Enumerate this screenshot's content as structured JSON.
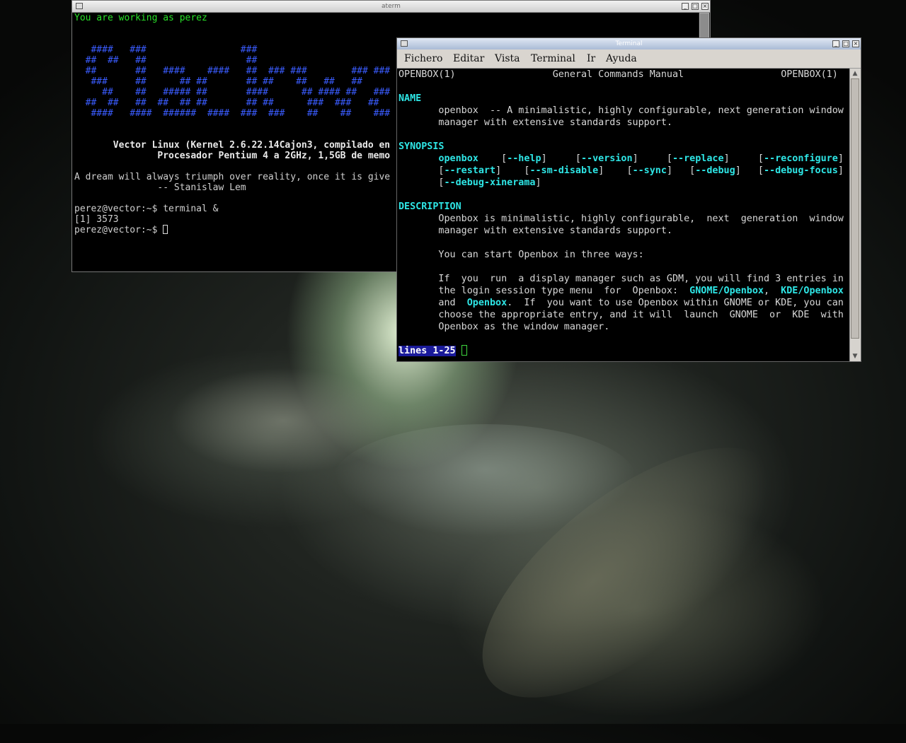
{
  "aterm": {
    "title": "aterm",
    "lines": [
      "You are working as perez",
      "",
      "",
      "   ####   ###                 ###",
      "  ##  ##   ##                  ##",
      "  ##       ##   ####    ####   ##  ### ###        ### ###",
      "   ###     ##      ## ##       ## ##    ##   ##   ##",
      "     ##    ##   ##### ##       ####      ## #### ##   ###",
      "  ##  ##   ##  ##  ## ##       ## ##      ###  ###   ##",
      "   ####   ####  ######  ####  ###  ###    ##    ##    ###",
      "",
      "",
      "       Vector Linux (Kernel 2.6.22.14Cajon3, compilado en",
      "               Procesador Pentium 4 a 2GHz, 1,5GB de memo",
      "",
      "A dream will always triumph over reality, once it is give",
      "               -- Stanislaw Lem",
      "",
      "perez@vector:~$ terminal &",
      "[1] 3573",
      "perez@vector:~$ "
    ]
  },
  "terminal": {
    "title": "Terminal",
    "menu": [
      "Fichero",
      "Editar",
      "Vista",
      "Terminal",
      "Ir",
      "Ayuda"
    ],
    "header_left": "OPENBOX(1)",
    "header_center": "General Commands Manual",
    "header_right": "OPENBOX(1)",
    "sections": {
      "name_heading": "NAME",
      "name_text_1": "       openbox  -- A minimalistic, highly configurable, next generation window",
      "name_text_2": "       manager with extensive standards support.",
      "synopsis_heading": "SYNOPSIS",
      "synopsis_cmd": "openbox",
      "options_line1": [
        "--help",
        "--version",
        "--replace",
        "--reconfigure"
      ],
      "options_line2": [
        "--restart",
        "--sm-disable",
        "--sync",
        "--debug",
        "--debug-focus"
      ],
      "options_line3": [
        "--debug-xinerama"
      ],
      "description_heading": "DESCRIPTION",
      "desc_1": "       Openbox is minimalistic, highly configurable,  next  generation  window",
      "desc_2": "       manager with extensive standards support.",
      "desc_3": "       You can start Openbox in three ways:",
      "desc_4": "       If  you  run  a display manager such as GDM, you will find 3 entries in",
      "desc_5a": "       the login session type menu  for  Openbox:  ",
      "link_gnome": "GNOME/Openbox",
      "link_kde": "KDE/Openbox",
      "desc_6a": "       and  ",
      "link_openbox": "Openbox",
      "desc_6b": ".  If  you want to use Openbox within GNOME or KDE, you can",
      "desc_7": "       choose the appropriate entry, and it will  launch  GNOME  or  KDE  with",
      "desc_8": "       Openbox as the window manager."
    },
    "status_line": "lines 1-25"
  },
  "colors": {
    "prompt_green": "#28e028",
    "logo_blue": "#3a5cff",
    "man_bold_cyan": "#2ee6e6",
    "status_bg": "#1a1a9a"
  }
}
